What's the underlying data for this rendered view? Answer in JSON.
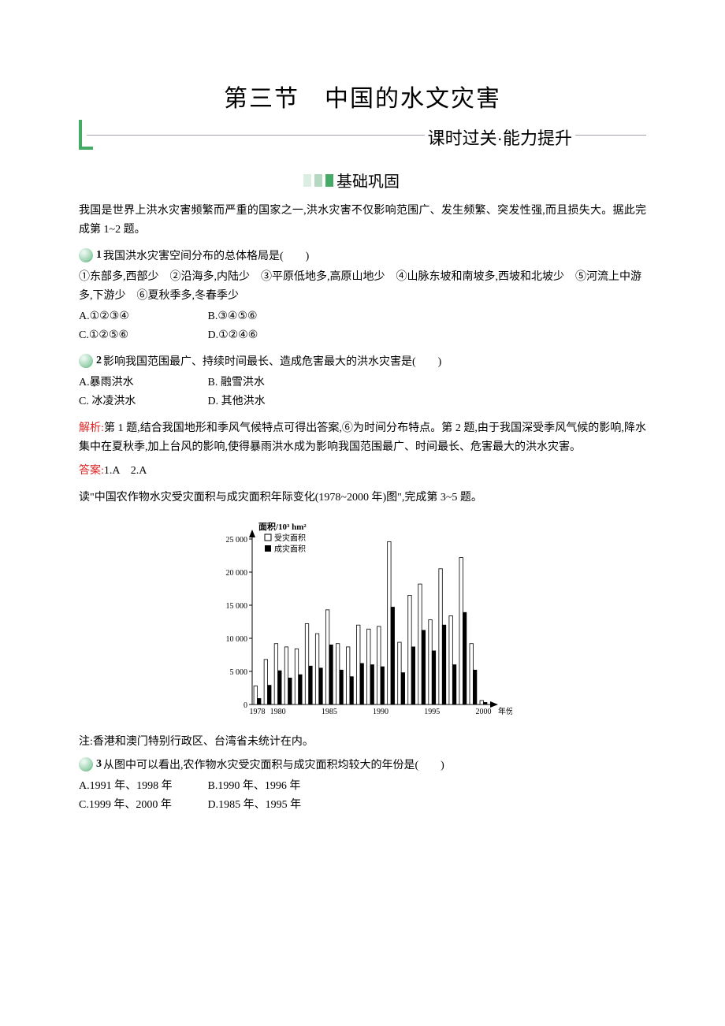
{
  "title": "第三节　中国的水文灾害",
  "header_label": "课时过关·能力提升",
  "section1": "基础巩固",
  "intro": "我国是世界上洪水灾害频繁而严重的国家之一,洪水灾害不仅影响范围广、发生频繁、突发性强,而且损失大。据此完成第 1~2 题。",
  "q1": {
    "num": "1",
    "stem": "我国洪水灾害空间分布的总体格局是(　　)",
    "roman": "①东部多,西部少　②沿海多,内陆少　③平原低地多,高原山地少　④山脉东坡和南坡多,西坡和北坡少　⑤河流上中游多,下游少　⑥夏秋季多,冬春季少",
    "opts": {
      "A": "A.①②③④",
      "B": "B.③④⑤⑥",
      "C": "C.①②⑤⑥",
      "D": "D.①②④⑥"
    }
  },
  "q2": {
    "num": "2",
    "stem": "影响我国范围最广、持续时间最长、造成危害最大的洪水灾害是(　　)",
    "opts": {
      "A": "A.暴雨洪水",
      "B": "B. 融雪洪水",
      "C": "C. 冰凌洪水",
      "D": "D. 其他洪水"
    }
  },
  "jiexi_label": "解析:",
  "jiexi_text": "第 1 题,结合我国地形和季风气候特点可得出答案,⑥为时间分布特点。第 2 题,由于我国深受季风气候的影响,降水集中在夏秋季,加上台风的影响,使得暴雨洪水成为影响我国范围最广、时间最长、危害最大的洪水灾害。",
  "daan_label": "答案:",
  "daan_text": "1.A　2.A",
  "fig_intro": "读\"中国农作物水灾受灾面积与成灾面积年际变化(1978~2000 年)图\",完成第 3~5 题。",
  "chart_data": {
    "type": "bar",
    "title": "",
    "ylabel": "面积/10³ hm²",
    "xlabel": "年份",
    "ylim": [
      0,
      25000
    ],
    "yticks": [
      0,
      5000,
      10000,
      15000,
      20000,
      25000
    ],
    "categories": [
      1978,
      1979,
      1980,
      1981,
      1982,
      1983,
      1984,
      1985,
      1986,
      1987,
      1988,
      1989,
      1990,
      1991,
      1992,
      1993,
      1994,
      1995,
      1996,
      1997,
      1998,
      1999,
      2000
    ],
    "x_tick_labels": [
      1978,
      1980,
      1985,
      1990,
      1995,
      2000
    ],
    "series": [
      {
        "name": "受灾面积",
        "color_fill": "#ffffff",
        "color_stroke": "#000",
        "values": [
          2800,
          6800,
          9200,
          8700,
          8400,
          12200,
          10700,
          14300,
          9200,
          8700,
          12000,
          11400,
          11800,
          24600,
          9400,
          16500,
          18200,
          12800,
          20500,
          13400,
          22200,
          9200,
          600
        ]
      },
      {
        "name": "成灾面积",
        "color_fill": "#000000",
        "color_stroke": "#000",
        "values": [
          900,
          2900,
          5100,
          4000,
          4500,
          5800,
          5500,
          9000,
          5200,
          4200,
          6200,
          6000,
          5700,
          14700,
          4800,
          8700,
          11200,
          8100,
          12000,
          6000,
          13900,
          5200,
          300
        ]
      }
    ],
    "legend": {
      "items": [
        "受灾面积",
        "成灾面积"
      ],
      "symbols": [
        "□",
        "■"
      ]
    }
  },
  "note": "注:香港和澳门特别行政区、台湾省未统计在内。",
  "q3": {
    "num": "3",
    "stem": "从图中可以看出,农作物水灾受灾面积与成灾面积均较大的年份是(　　)",
    "opts": {
      "A": "A.1991 年、1998 年",
      "B": "B.1990 年、1996 年",
      "C": "C.1999 年、2000 年",
      "D": "D.1985 年、1995 年"
    }
  }
}
